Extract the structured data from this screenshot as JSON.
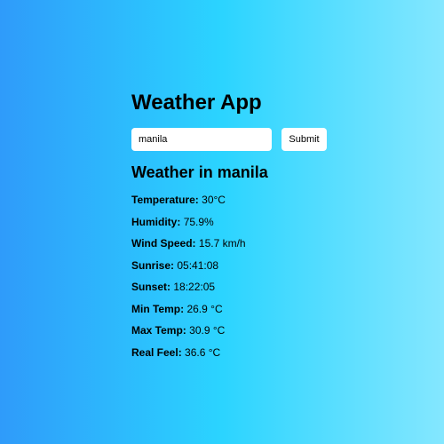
{
  "app": {
    "title": "Weather App"
  },
  "search": {
    "value": "manila",
    "submit_label": "Submit"
  },
  "weather": {
    "heading": "Weather in manila",
    "stats": [
      {
        "label": "Temperature:",
        "value": "30°C"
      },
      {
        "label": "Humidity:",
        "value": "75.9%"
      },
      {
        "label": "Wind Speed:",
        "value": "15.7 km/h"
      },
      {
        "label": "Sunrise:",
        "value": "05:41:08"
      },
      {
        "label": "Sunset:",
        "value": "18:22:05"
      },
      {
        "label": "Min Temp:",
        "value": "26.9 °C"
      },
      {
        "label": "Max Temp:",
        "value": "30.9 °C"
      },
      {
        "label": "Real Feel:",
        "value": "36.6 °C"
      }
    ]
  },
  "colors": {
    "gradient_start": "#2f9bfa",
    "gradient_mid": "#2bd4ff",
    "gradient_end": "#84e7ff"
  }
}
